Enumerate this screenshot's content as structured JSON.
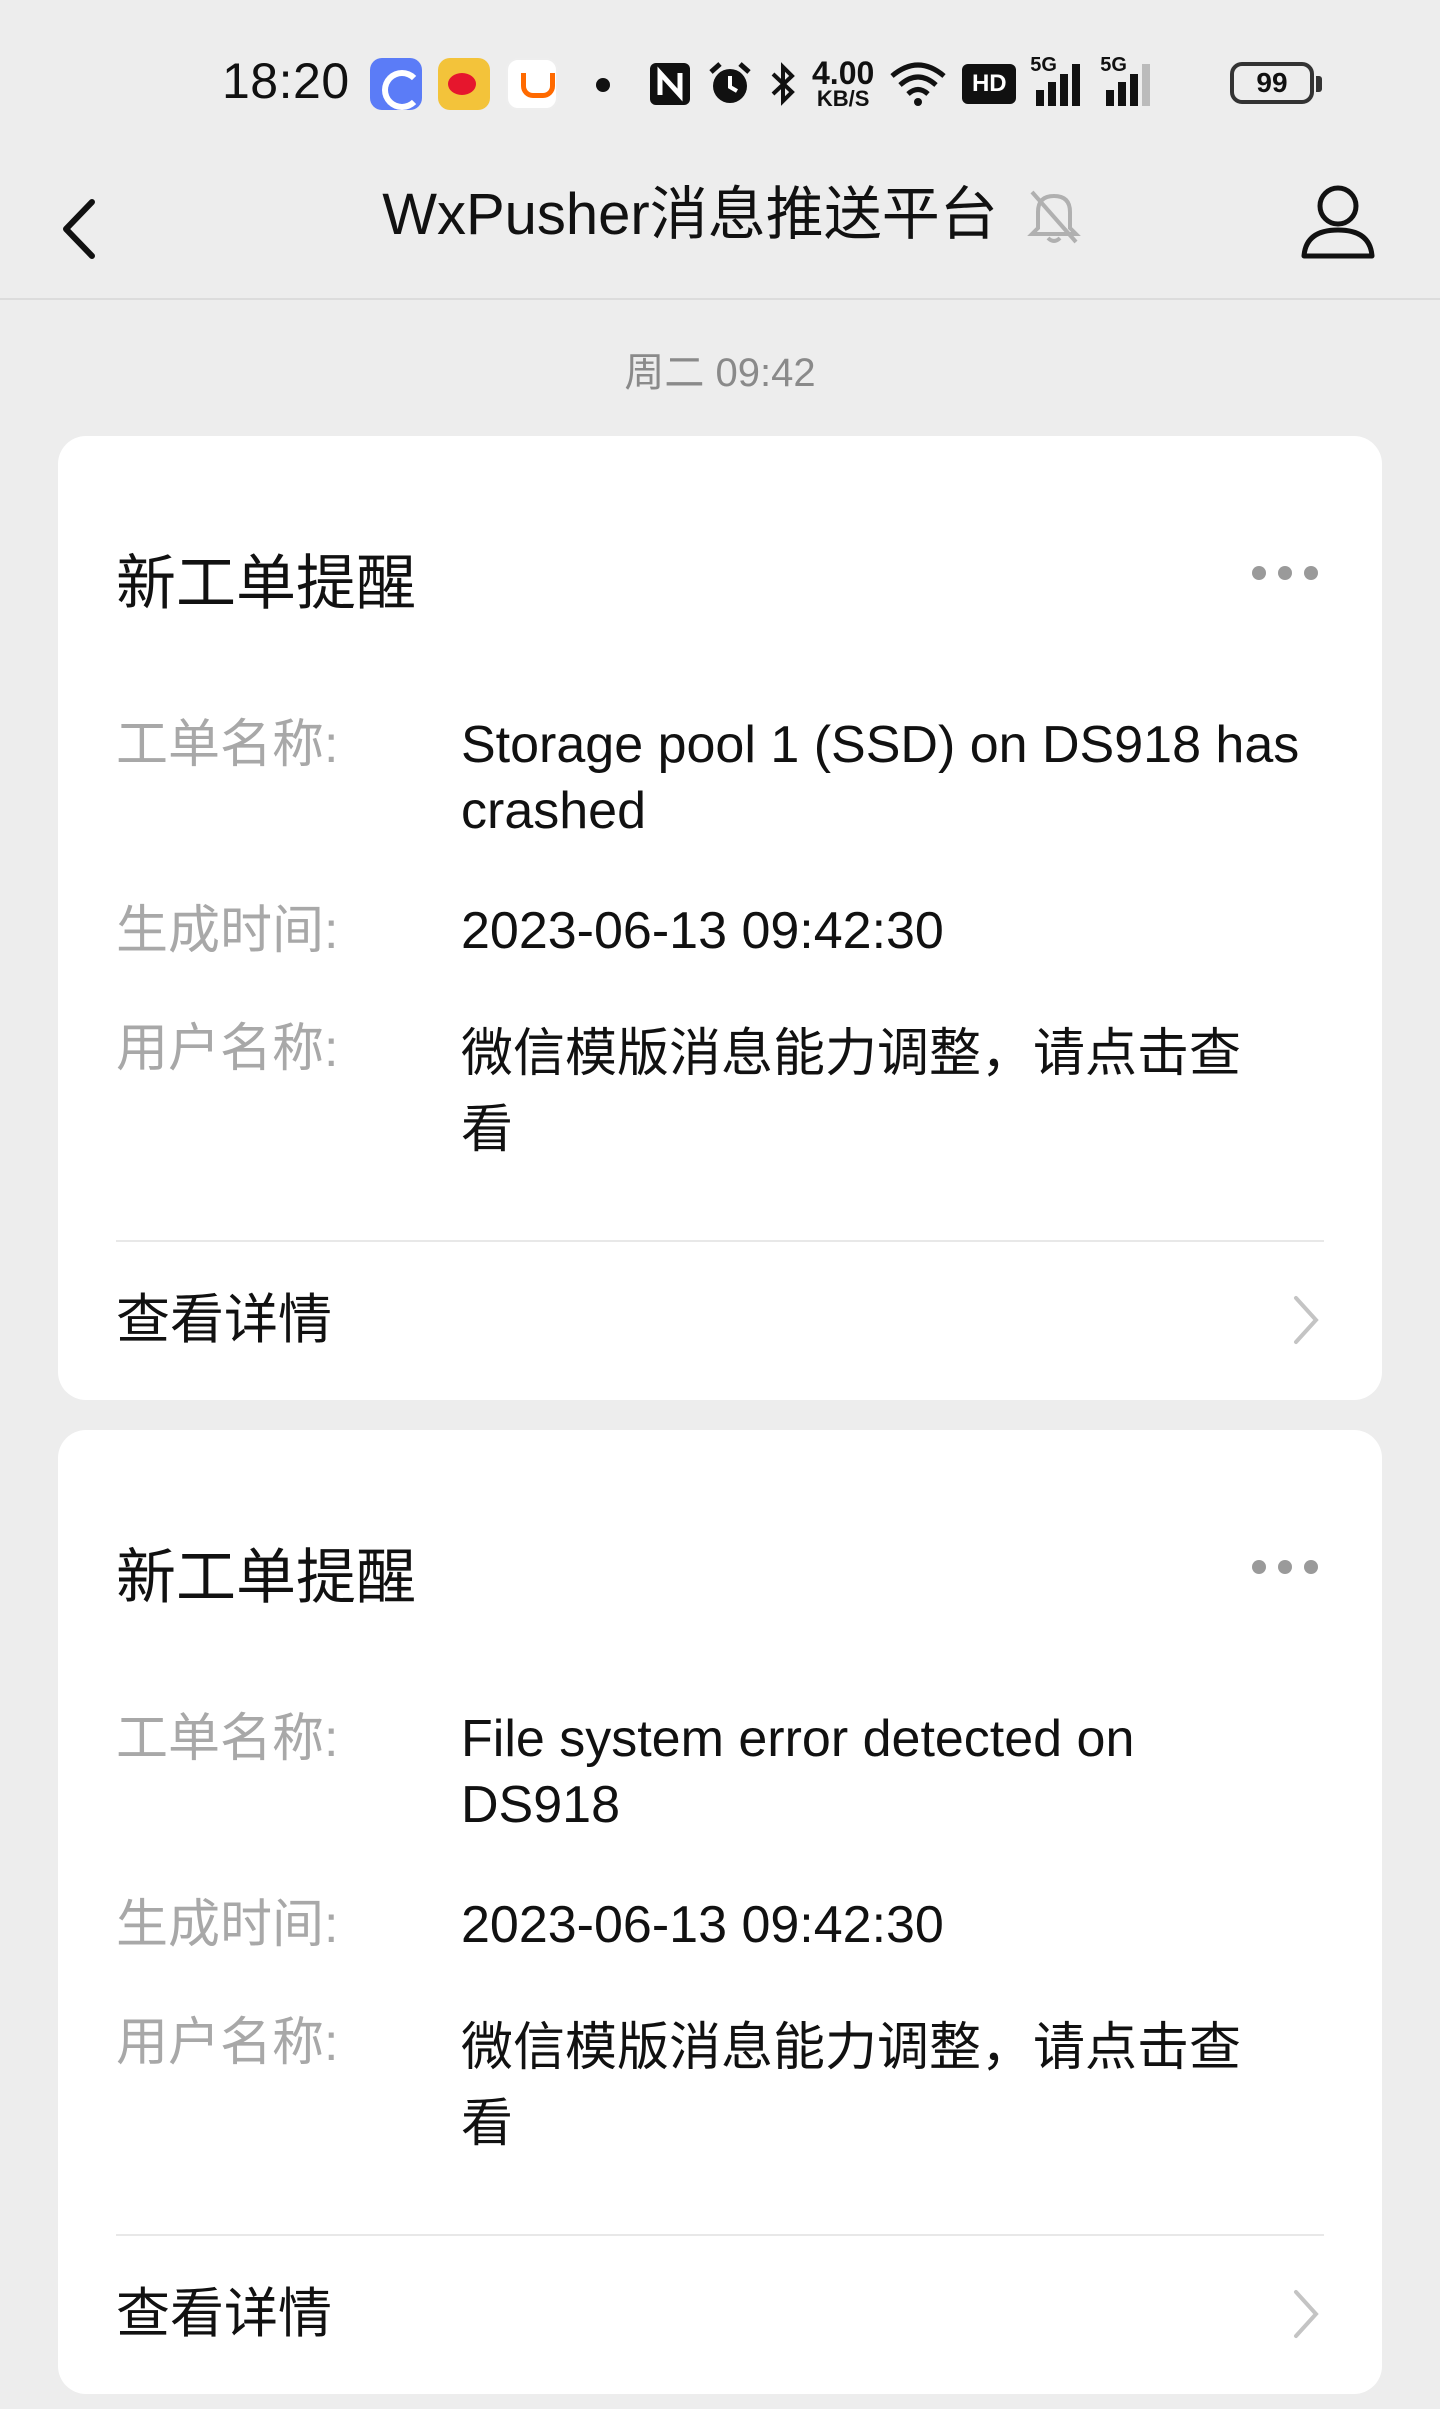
{
  "status_bar": {
    "time": "18:20",
    "net_speed_value": "4.00",
    "net_speed_unit": "KB/S",
    "hd_label": "HD",
    "signal_1_label": "5G",
    "signal_2_label": "5G",
    "battery": "99",
    "apps": [
      "app-icon",
      "weibo-icon",
      "taobao-icon"
    ]
  },
  "nav": {
    "title": "WxPusher消息推送平台",
    "icons": [
      "back-icon",
      "mute-bell-icon",
      "user-icon"
    ]
  },
  "timestamp": "周二 09:42",
  "cards": [
    {
      "title": "新工单提醒",
      "fields": [
        {
          "label": "工单名称:",
          "value": "Storage pool 1 (SSD) on DS918 has crashed"
        },
        {
          "label": "生成时间:",
          "value": "2023-06-13 09:42:30"
        },
        {
          "label": "用户名称:",
          "value": "微信模版消息能力调整，请点击查看"
        }
      ],
      "detail_label": "查看详情"
    },
    {
      "title": "新工单提醒",
      "fields": [
        {
          "label": "工单名称:",
          "value": "File system error detected on DS918"
        },
        {
          "label": "生成时间:",
          "value": "2023-06-13 09:42:30"
        },
        {
          "label": "用户名称:",
          "value": "微信模版消息能力调整，请点击查看"
        }
      ],
      "detail_label": "查看详情"
    }
  ],
  "colors": {
    "background": "#ededed",
    "card": "#ffffff",
    "label": "#a8a8a8",
    "text": "#111111",
    "timestamp": "#8a8a8a"
  }
}
